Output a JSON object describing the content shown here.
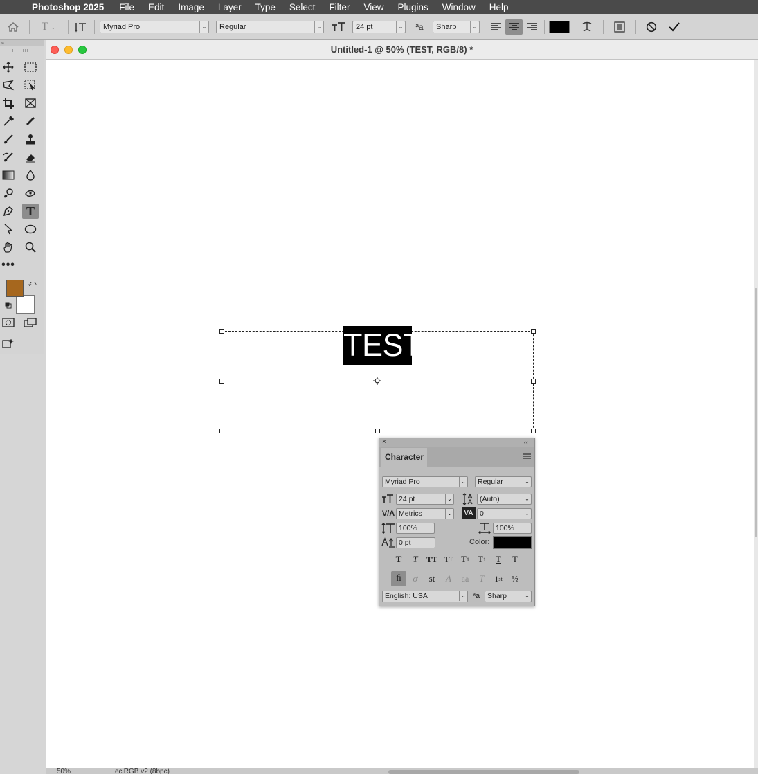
{
  "menubar": {
    "app": "Photoshop 2025",
    "items": [
      "File",
      "Edit",
      "Image",
      "Layer",
      "Type",
      "Select",
      "Filter",
      "View",
      "Plugins",
      "Window",
      "Help"
    ]
  },
  "options": {
    "font_family": "Myriad Pro",
    "font_style": "Regular",
    "font_size": "24 pt",
    "antialias": "Sharp",
    "text_color": "#000000"
  },
  "tools": {
    "foreground_color": "#a6671e",
    "background_color": "#ffffff"
  },
  "document": {
    "title": "Untitled-1 @ 50% (TEST, RGB/8) *",
    "text_content": "TEST",
    "status_zoom": "50%",
    "status_profile": "eciRGB v2 (8bpc)"
  },
  "character_panel": {
    "tab": "Character",
    "font_family": "Myriad Pro",
    "font_style": "Regular",
    "size": "24 pt",
    "leading": "(Auto)",
    "kerning": "Metrics",
    "tracking": "0",
    "vertical_scale": "100%",
    "horizontal_scale": "100%",
    "baseline_shift": "0 pt",
    "color_label": "Color:",
    "color": "#000000",
    "language": "English: USA",
    "antialias": "Sharp"
  }
}
